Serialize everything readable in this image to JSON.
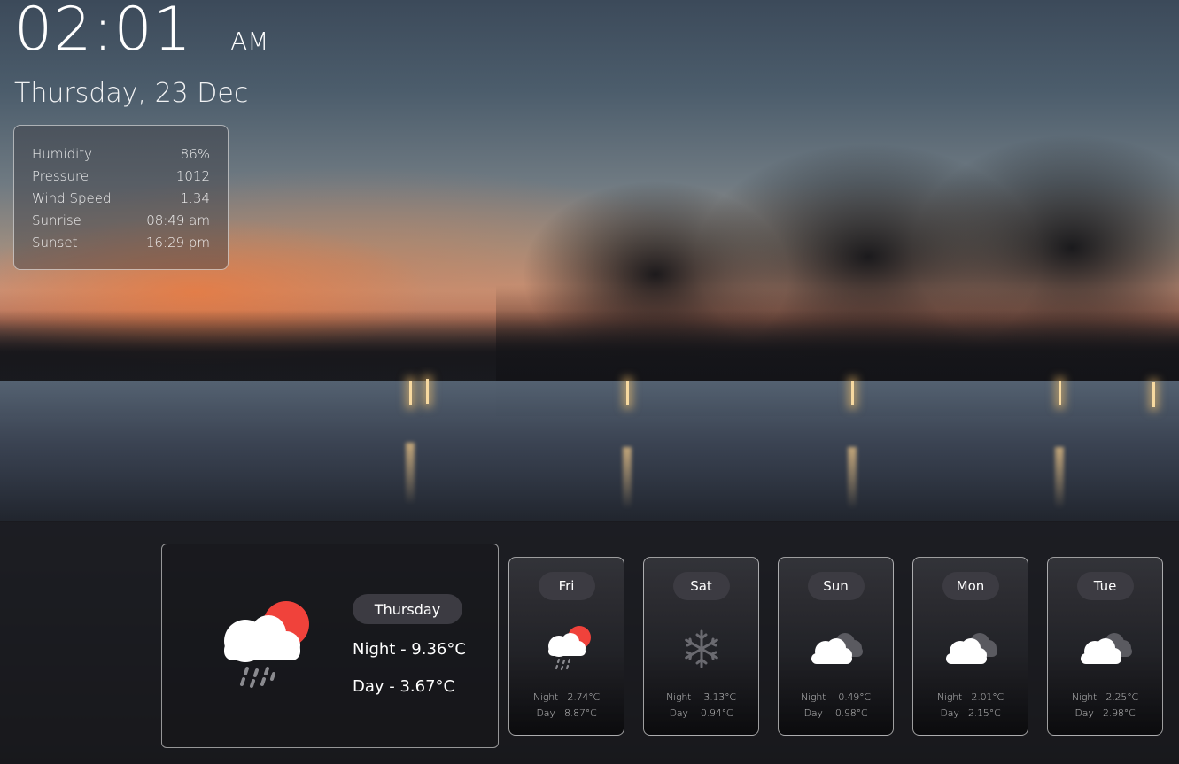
{
  "clock": {
    "time": "02:01",
    "ampm": "AM"
  },
  "date": "Thursday, 23 Dec",
  "details": [
    {
      "label": "Humidity",
      "value": "86%"
    },
    {
      "label": "Pressure",
      "value": "1012"
    },
    {
      "label": "Wind Speed",
      "value": "1.34"
    },
    {
      "label": "Sunrise",
      "value": "08:49 am"
    },
    {
      "label": "Sunset",
      "value": "16:29 pm"
    }
  ],
  "today": {
    "day": "Thursday",
    "night": "Night - 9.36°C",
    "day_temp": "Day - 3.67°C",
    "icon": "rain-sun-icon"
  },
  "forecast": [
    {
      "day": "Fri",
      "night": "Night - 2.74°C",
      "day_temp": "Day - 8.87°C",
      "icon": "rain-sun-icon"
    },
    {
      "day": "Sat",
      "night": "Night - -3.13°C",
      "day_temp": "Day - -0.94°C",
      "icon": "snowflake-icon"
    },
    {
      "day": "Sun",
      "night": "Night - -0.49°C",
      "day_temp": "Day - -0.98°C",
      "icon": "cloud-icon"
    },
    {
      "day": "Mon",
      "night": "Night - 2.01°C",
      "day_temp": "Day - 2.15°C",
      "icon": "cloud-icon"
    },
    {
      "day": "Tue",
      "night": "Night - 2.25°C",
      "day_temp": "Day - 2.98°C",
      "icon": "cloud-icon"
    }
  ]
}
